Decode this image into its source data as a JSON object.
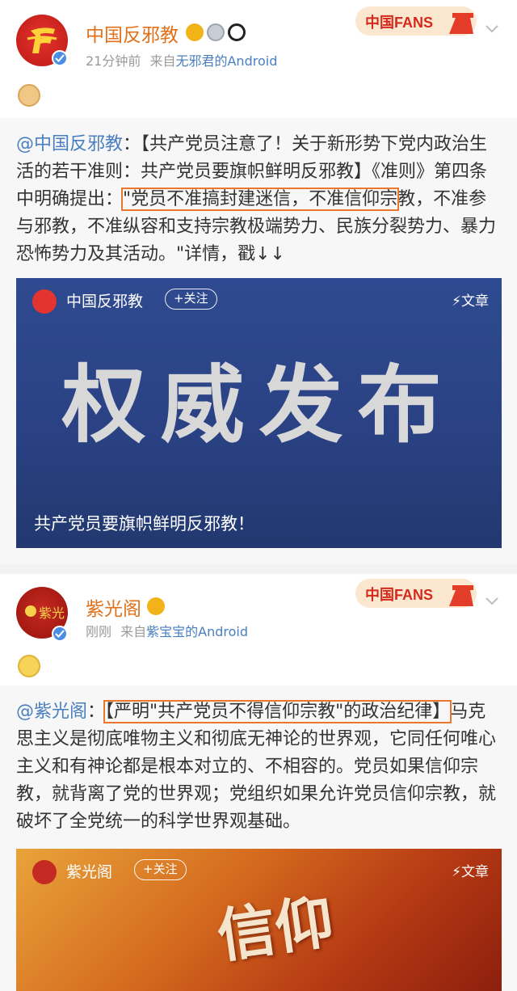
{
  "post1": {
    "username": "中国反邪教",
    "time": "21分钟前",
    "source_prefix": "来自",
    "source": "无邪君的Android",
    "text_mention": "@中国反邪教",
    "text_before": "：【共产党员注意了！关于新形势下党内政治生活的若干准则：共产党员要旗帜鲜明反邪教】《准则》第四条中明确提出：",
    "text_highlight": "\"党员不准搞封建迷信，不准信仰宗",
    "text_after": "教，不准参与邪教，不准纵容和支持宗教极端势力、民族分裂势力、暴力恐怖势力及其活动。\"详情，戳↓↓",
    "card": {
      "account": "中国反邪教",
      "follow_label": "+关注",
      "article_label": "文章",
      "big_title": "权威发布",
      "subtitle": "共产党员要旗帜鲜明反邪教！"
    }
  },
  "post2": {
    "username": "紫光阁",
    "time": "刚刚",
    "source_prefix": "来自",
    "source": "紫宝宝的Android",
    "text_mention": "@紫光阁",
    "text_before": "：",
    "text_highlight": "【严明\"共产党员不得信仰宗教\"的政治纪律】",
    "text_after": "马克思主义是彻底唯物主义和彻底无神论的世界观，它同任何唯心主义和有神论都是根本对立的、不相容的。党员如果信仰宗教，就背离了党的世界观；党组织如果允许党员信仰宗教，就破坏了全党统一的科学世界观基础。",
    "card": {
      "account": "紫光阁",
      "follow_label": "+关注",
      "article_label": "文章",
      "poster_text": "信仰"
    }
  },
  "fans_badge": "中国FANS",
  "colors": {
    "username": "#e0711a",
    "link": "#4a7fbf",
    "highlight_box": "#e9772c",
    "card1_bg": "#2a4284",
    "verified": "#4a8fe3"
  },
  "icons": [
    "verified-icon",
    "crown-badge-icon",
    "panda-icon",
    "doge-emoji-icon",
    "smile-emoji-icon",
    "chevron-down-icon",
    "lightning-icon"
  ]
}
